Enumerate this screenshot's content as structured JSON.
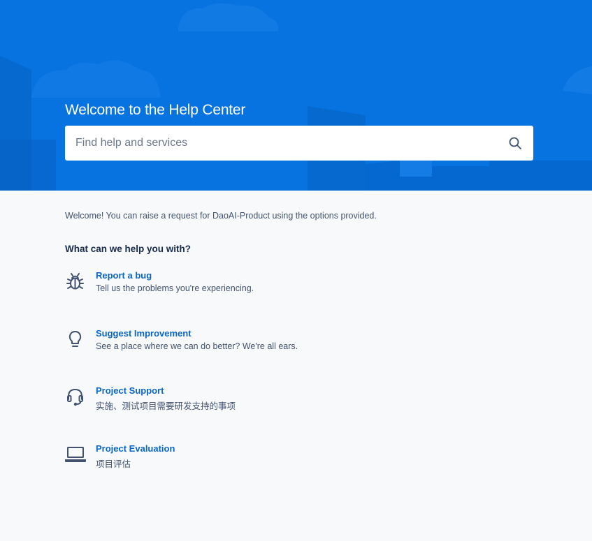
{
  "hero": {
    "title": "Welcome to the Help Center",
    "search_placeholder": "Find help and services",
    "background_color": "#0773e0"
  },
  "intro_text": "Welcome! You can raise a request for DaoAI-Product using the options provided.",
  "section_heading": "What can we help you with?",
  "request_types": [
    {
      "icon": "bug-icon",
      "title": "Report a bug",
      "description": "Tell us the problems you're experiencing."
    },
    {
      "icon": "lightbulb-icon",
      "title": "Suggest Improvement",
      "description": "See a place where we can do better? We're all ears."
    },
    {
      "icon": "headset-icon",
      "title": "Project Support",
      "description": "实施、测试项目需要研发支持的事项"
    },
    {
      "icon": "laptop-icon",
      "title": "Project Evaluation",
      "description": "项目评估"
    }
  ],
  "colors": {
    "link": "#0b66c3",
    "text_muted": "#42526e",
    "page_bg": "#f8f9fb"
  }
}
